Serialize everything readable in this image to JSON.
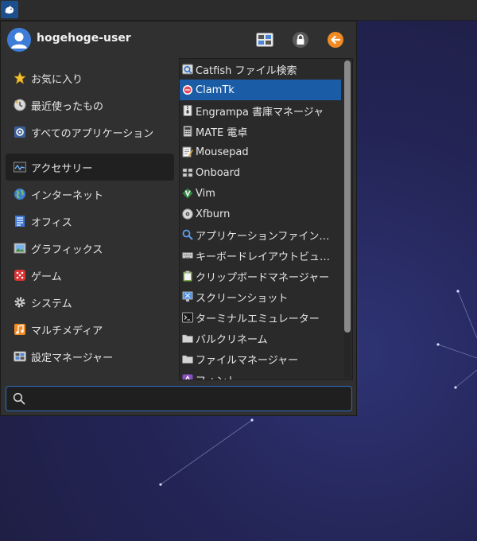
{
  "user": {
    "name": "hogehoge-user"
  },
  "header_buttons": [
    "settings-manager-icon",
    "lock-screen-icon",
    "logout-icon"
  ],
  "categories": [
    {
      "label": "お気に入り",
      "icon": "star-icon",
      "selected": false
    },
    {
      "label": "最近使ったもの",
      "icon": "recent-icon",
      "selected": false
    },
    {
      "label": "すべてのアプリケーション",
      "icon": "all-apps-icon",
      "selected": false
    },
    {
      "label": "アクセサリー",
      "icon": "accessories-icon",
      "selected": true
    },
    {
      "label": "インターネット",
      "icon": "globe-icon",
      "selected": false
    },
    {
      "label": "オフィス",
      "icon": "office-icon",
      "selected": false
    },
    {
      "label": "グラフィックス",
      "icon": "graphics-icon",
      "selected": false
    },
    {
      "label": "ゲーム",
      "icon": "dice-icon",
      "selected": false
    },
    {
      "label": "システム",
      "icon": "gear-icon",
      "selected": false
    },
    {
      "label": "マルチメディア",
      "icon": "music-icon",
      "selected": false
    },
    {
      "label": "設定マネージャー",
      "icon": "settings-icon",
      "selected": false
    }
  ],
  "apps": [
    {
      "label": "Catfish ファイル検索",
      "icon": "catfish-icon",
      "selected": false
    },
    {
      "label": "ClamTk",
      "icon": "clamtk-icon",
      "selected": true
    },
    {
      "label": "Engrampa 書庫マネージャ",
      "icon": "archive-icon",
      "selected": false
    },
    {
      "label": "MATE 電卓",
      "icon": "calculator-icon",
      "selected": false
    },
    {
      "label": "Mousepad",
      "icon": "text-editor-icon",
      "selected": false
    },
    {
      "label": "Onboard",
      "icon": "keyboard-onscreen-icon",
      "selected": false
    },
    {
      "label": "Vim",
      "icon": "vim-icon",
      "selected": false
    },
    {
      "label": "Xfburn",
      "icon": "disc-icon",
      "selected": false
    },
    {
      "label": "アプリケーションファイン…",
      "icon": "magnifier-icon",
      "selected": false
    },
    {
      "label": "キーボードレイアウトビュ…",
      "icon": "keyboard-icon",
      "selected": false
    },
    {
      "label": "クリップボードマネージャー",
      "icon": "clipboard-icon",
      "selected": false
    },
    {
      "label": "スクリーンショット",
      "icon": "screenshot-icon",
      "selected": false
    },
    {
      "label": "ターミナルエミュレーター",
      "icon": "terminal-icon",
      "selected": false
    },
    {
      "label": "バルクリネーム",
      "icon": "folder-icon",
      "selected": false
    },
    {
      "label": "ファイルマネージャー",
      "icon": "folder-icon",
      "selected": false
    },
    {
      "label": "フォント",
      "icon": "font-icon",
      "selected": false
    }
  ],
  "search": {
    "placeholder": "",
    "value": ""
  },
  "colors": {
    "accent": "#1b5ca6",
    "focus_border": "#2f6cc0",
    "menu_bg": "#303030"
  }
}
